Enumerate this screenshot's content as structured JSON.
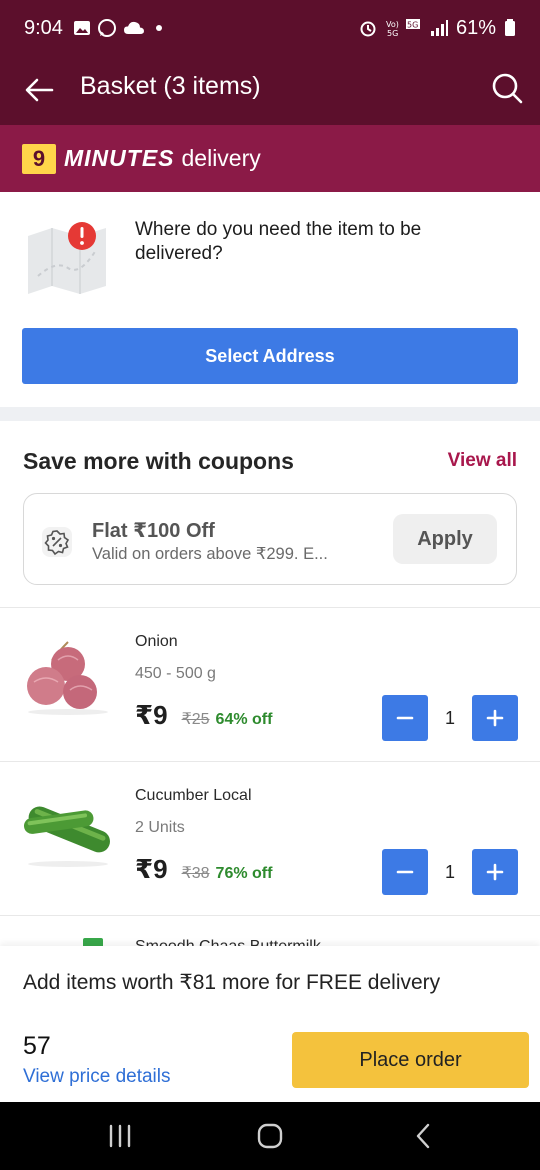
{
  "status_bar": {
    "time": "9:04",
    "battery": "61%"
  },
  "header": {
    "title": "Basket (3 items)"
  },
  "banner": {
    "minutes": "9",
    "minutes_word": "MINUTES",
    "delivery_word": "delivery"
  },
  "address": {
    "question": "Where do you need the item to be delivered?",
    "button": "Select Address"
  },
  "coupons": {
    "heading": "Save more with coupons",
    "view_all": "View all",
    "card": {
      "title": "Flat ₹100 Off",
      "subtitle": "Valid on orders above ₹299. E...",
      "apply": "Apply"
    }
  },
  "items": [
    {
      "name": "Onion",
      "size": "450 - 500 g",
      "price": "₹9",
      "mrp": "₹25",
      "discount": "64% off",
      "qty": "1",
      "image": "onion-image"
    },
    {
      "name": "Cucumber Local",
      "size": "2 Units",
      "price": "₹9",
      "mrp": "₹38",
      "discount": "76% off",
      "qty": "1",
      "image": "cucumber-image"
    },
    {
      "name": "Smoodh Chaas Buttermilk",
      "image": "buttermilk-image"
    }
  ],
  "checkout": {
    "free_delivery_note": "Add items worth ₹81 more for FREE delivery",
    "total": "57",
    "view_price_details": "View price details",
    "place_order": "Place order"
  },
  "colors": {
    "header": "#5c0f2c",
    "banner": "#8b1a47",
    "accent_blue": "#3d7ae5",
    "place_order": "#f4c23d",
    "view_all": "#a8174c"
  }
}
